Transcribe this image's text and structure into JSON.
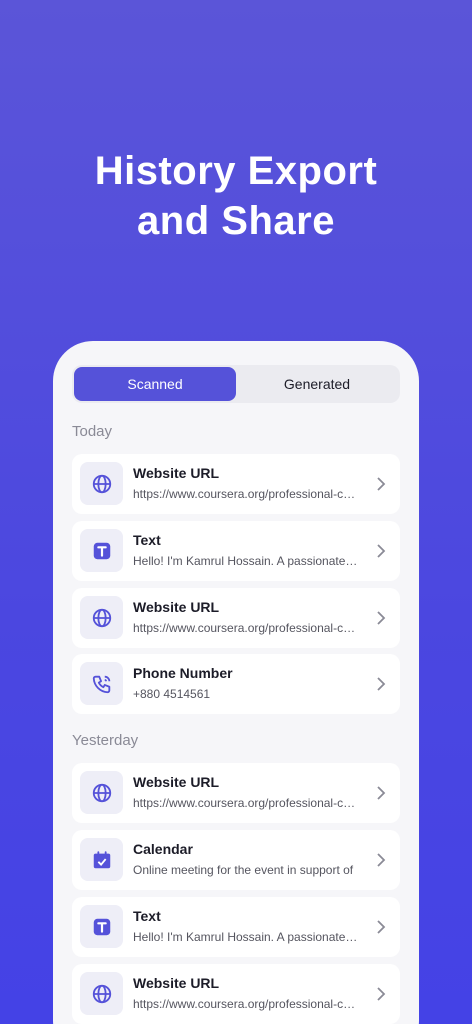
{
  "headline": {
    "line1": "History Export",
    "line2": "and Share"
  },
  "tabs": [
    {
      "label": "Scanned",
      "active": true
    },
    {
      "label": "Generated",
      "active": false
    }
  ],
  "sections": [
    {
      "label": "Today",
      "items": [
        {
          "icon": "globe-icon",
          "title": "Website URL",
          "subtitle": "https://www.coursera.org/professional-certificates"
        },
        {
          "icon": "text-icon",
          "title": "Text",
          "subtitle": "Hello! I'm Kamrul Hossain. A passionate designer"
        },
        {
          "icon": "globe-icon",
          "title": "Website URL",
          "subtitle": "https://www.coursera.org/professional-certificates"
        },
        {
          "icon": "phone-icon",
          "title": "Phone Number",
          "subtitle": "+880 4514561"
        }
      ]
    },
    {
      "label": "Yesterday",
      "items": [
        {
          "icon": "globe-icon",
          "title": "Website URL",
          "subtitle": "https://www.coursera.org/professional-certificates"
        },
        {
          "icon": "calendar-icon",
          "title": "Calendar",
          "subtitle": "Online meeting for the event in support of"
        },
        {
          "icon": "text-icon",
          "title": "Text",
          "subtitle": "Hello! I'm Kamrul Hossain. A passionate designer"
        },
        {
          "icon": "globe-icon",
          "title": "Website URL",
          "subtitle": "https://www.coursera.org/professional-certificates"
        }
      ]
    }
  ],
  "colors": {
    "accent": "#5552d9",
    "background": "#4b47e0",
    "card": "#ffffff"
  }
}
